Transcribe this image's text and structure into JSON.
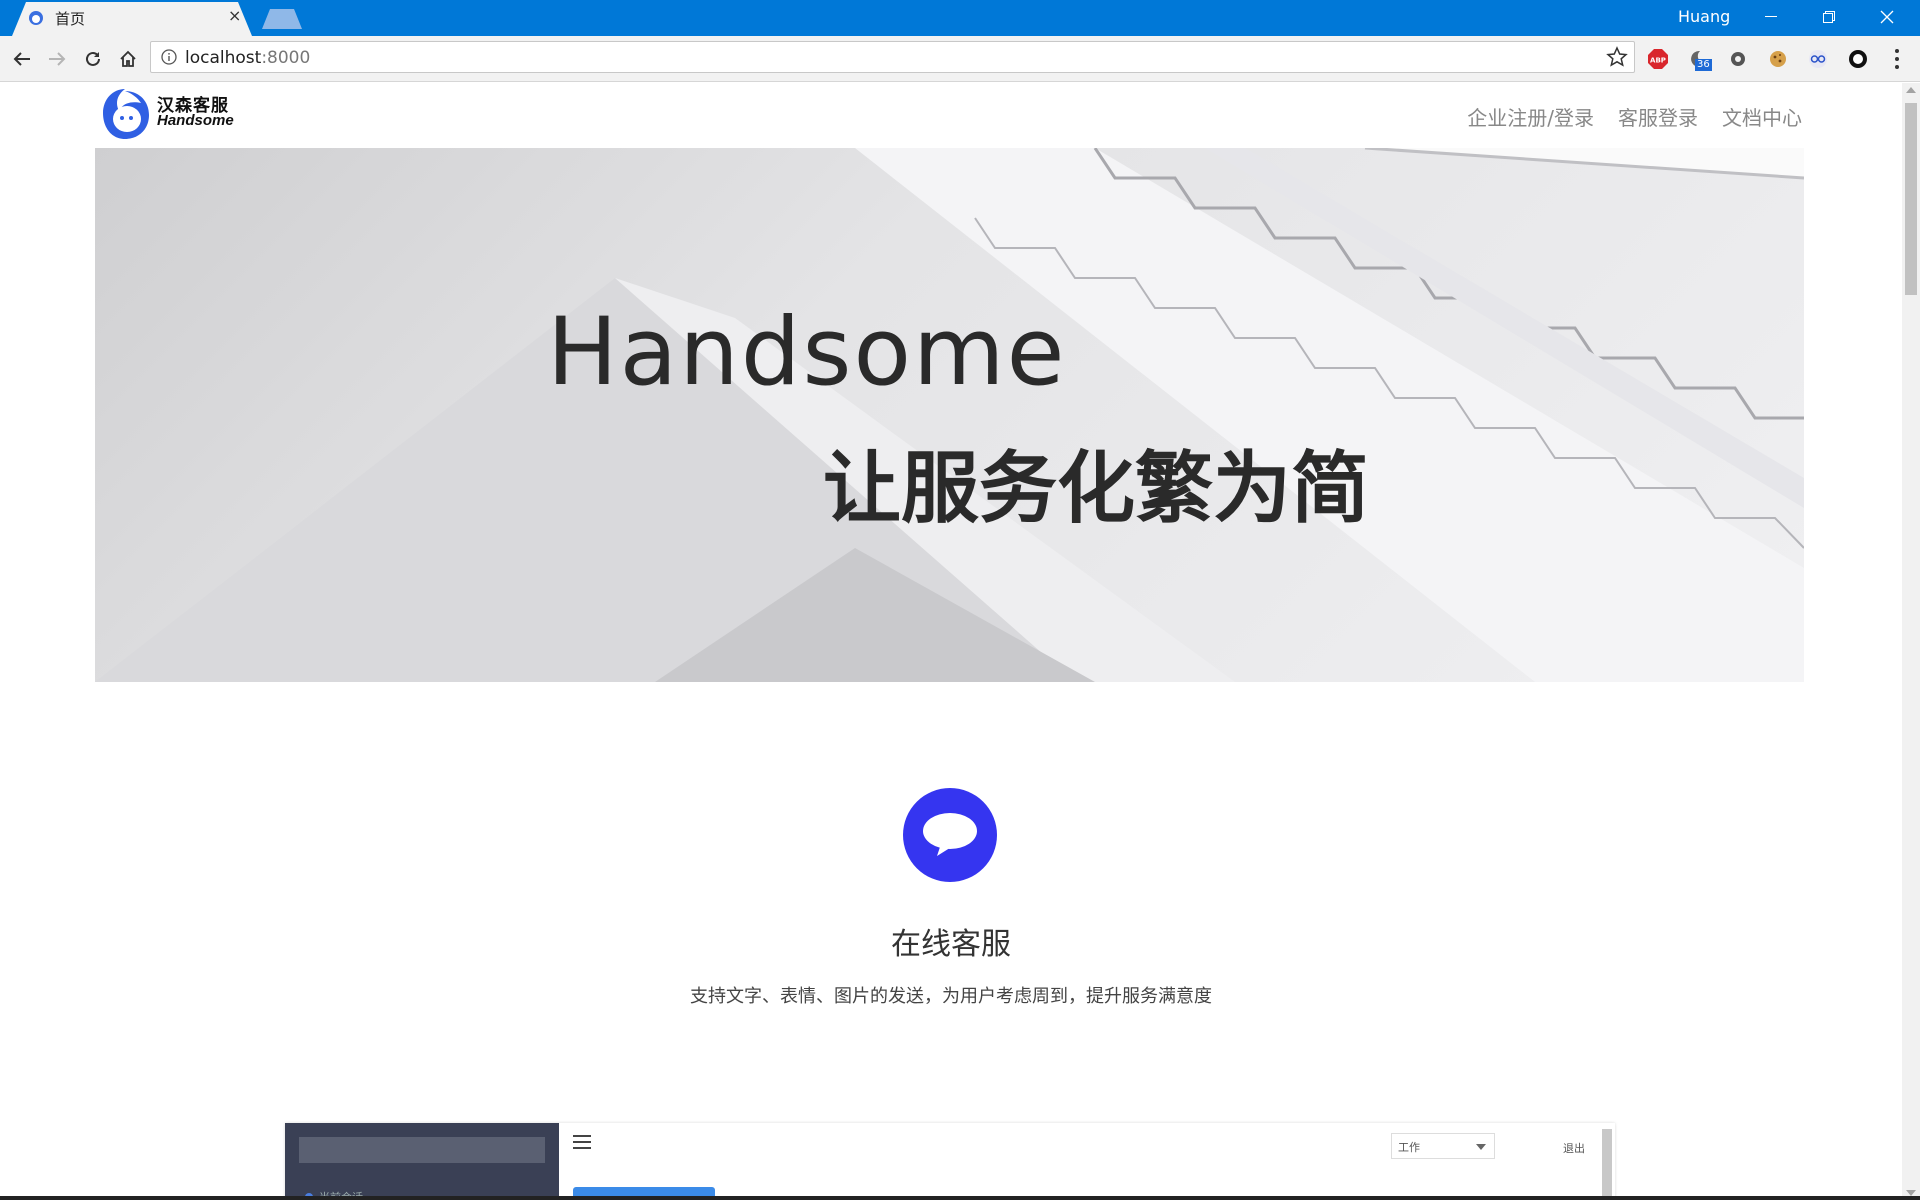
{
  "browser": {
    "tab_title": "首页",
    "tab_close": "×",
    "profile_name": "Huang",
    "url_host": "localhost",
    "url_port": ":8000",
    "extension_badge": "36",
    "abp_label": "ABP",
    "accent_color": "#0078d7"
  },
  "site": {
    "logo_cn": "汉森客服",
    "logo_en": "Handsome",
    "nav": [
      "企业注册/登录",
      "客服登录",
      "文档中心"
    ],
    "banner_title_en": "Handsome",
    "banner_title_cn": "让服务化繁为简",
    "feature": {
      "title": "在线客服",
      "description": "支持文字、表情、图片的发送，为用户考虑周到，提升服务满意度",
      "icon": "chat-bubble-icon",
      "icon_color": "#3535f0"
    },
    "preview": {
      "select_value": "工作",
      "logout_label": "退出",
      "sidebar_item": "当前会话"
    }
  }
}
